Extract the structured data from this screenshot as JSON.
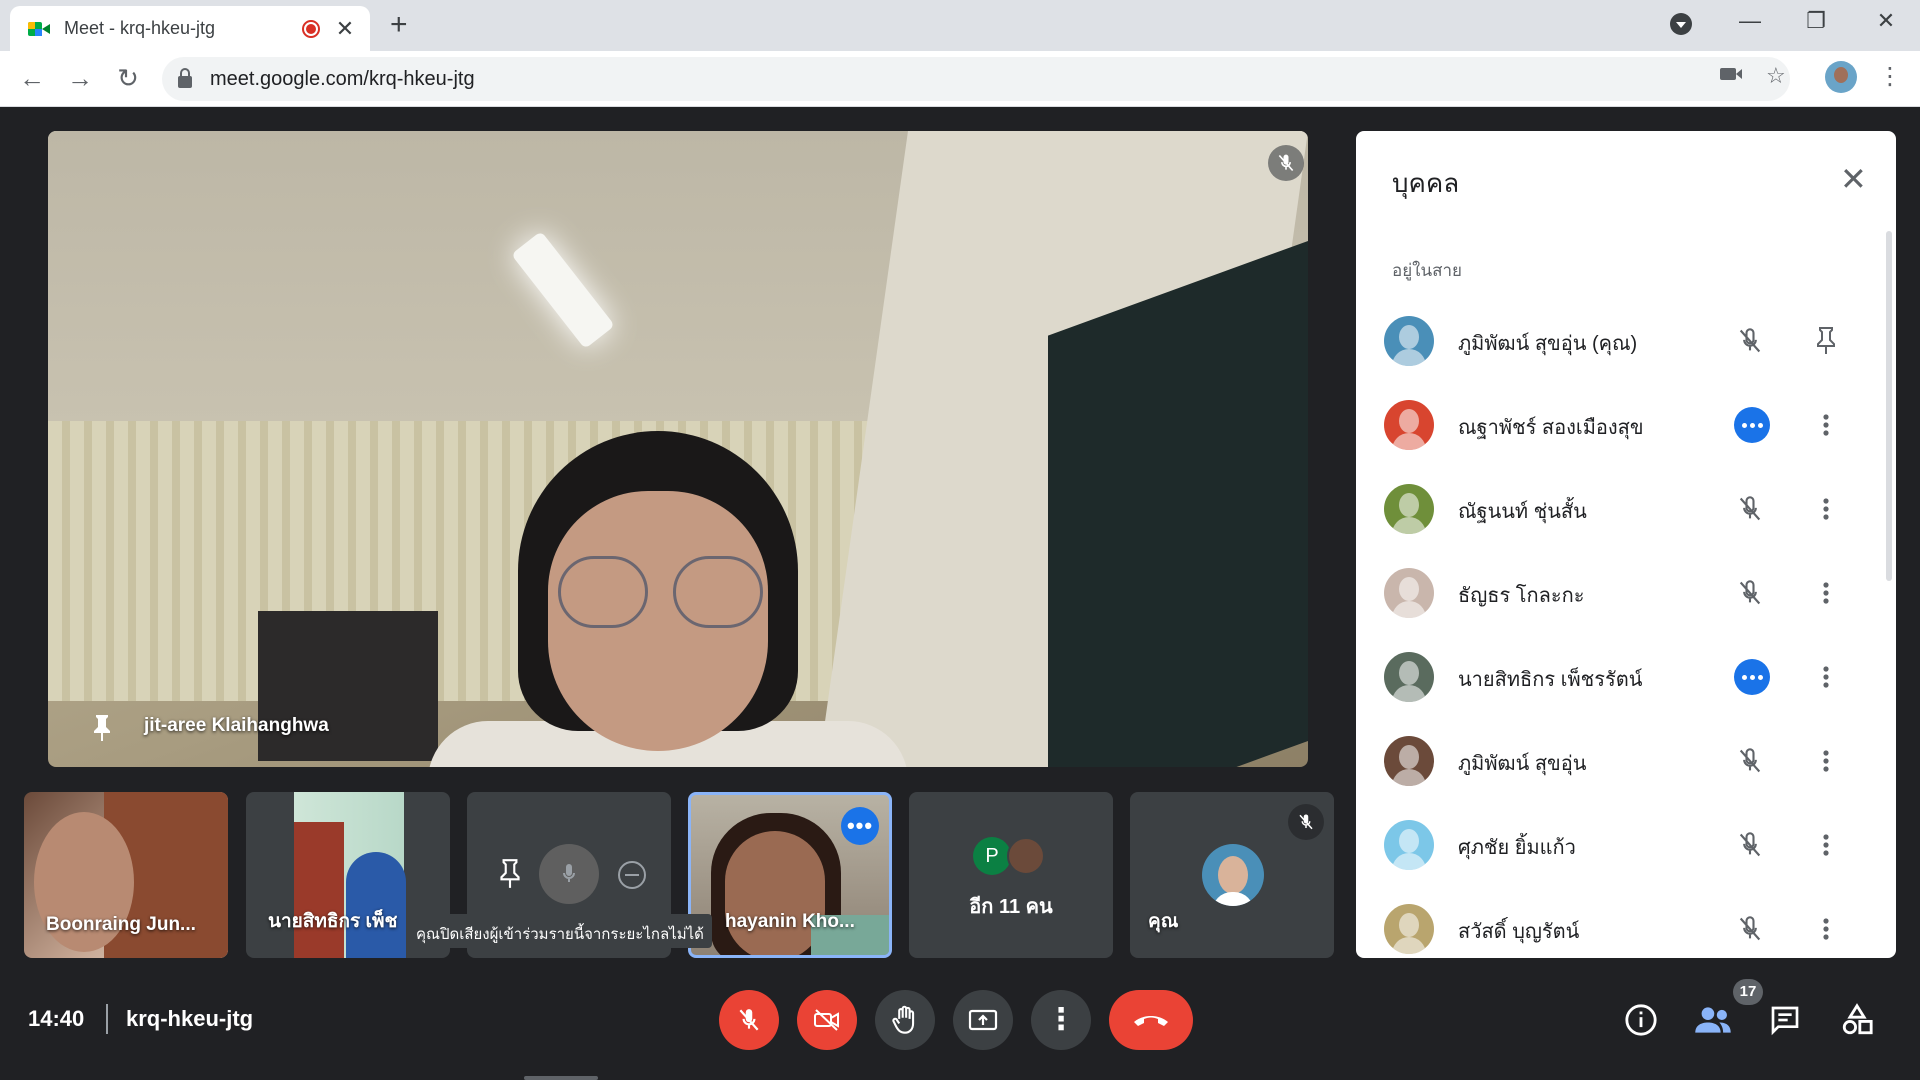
{
  "browser": {
    "tab_title": "Meet - krq-hkeu-jtg",
    "tab_close": "✕",
    "new_tab": "+",
    "url": "meet.google.com/krq-hkeu-jtg",
    "window_min": "—",
    "window_max": "❐",
    "window_close": "✕",
    "nav_back": "←",
    "nav_forward": "→",
    "nav_reload": "↻",
    "star": "☆",
    "menu": "⋮"
  },
  "main_video": {
    "participant_name": "jit-aree Klaihanghwa",
    "pinned": true,
    "muted": true
  },
  "thumbnails": [
    {
      "name": "Boonraing Jun...",
      "state": "video"
    },
    {
      "name": "นายสิทธิกร เพ็ช",
      "state": "video"
    },
    {
      "name": "",
      "state": "hover-controls"
    },
    {
      "name": "hayanin Kho...",
      "state": "video-active-speaking"
    },
    {
      "name": "อีก 11 คน",
      "state": "overflow",
      "letter": "P"
    },
    {
      "name": "คุณ",
      "state": "self-muted"
    }
  ],
  "tooltip": "คุณปิดเสียงผู้เข้าร่วมรายนี้จากระยะไกลไม่ได้",
  "bottom_bar": {
    "time": "14:40",
    "meeting_code": "krq-hkeu-jtg",
    "participant_count": "17",
    "more_options": "⋮"
  },
  "people_panel": {
    "title": "บุคคล",
    "close": "✕",
    "section_label": "อยู่ในสาย",
    "people": [
      {
        "name": "ภูมิพัฒน์ สุขอุ่น (คุณ)",
        "mic": "muted",
        "action": "pin",
        "avatar_color": "#4a8fb8"
      },
      {
        "name": "ณฐาพัชร์ สองเมืองสุข",
        "mic": "speaking",
        "action": "more",
        "avatar_color": "#d8452f"
      },
      {
        "name": "ณัฐนนท์ ชุ่นสั้น",
        "mic": "muted",
        "action": "more",
        "avatar_color": "#6f8f3a"
      },
      {
        "name": "ธัญธร โกละกะ",
        "mic": "muted",
        "action": "more",
        "avatar_color": "#c9b6ac"
      },
      {
        "name": "นายสิทธิกร เพ็ชรรัตน์",
        "mic": "speaking",
        "action": "more",
        "avatar_color": "#5a6b5e"
      },
      {
        "name": "ภูมิพัฒน์ สุขอุ่น",
        "mic": "muted",
        "action": "more",
        "avatar_color": "#6b4a3a"
      },
      {
        "name": "ศุภชัย ยิ้มแก้ว",
        "mic": "muted",
        "action": "more",
        "avatar_color": "#7cc7e8"
      },
      {
        "name": "สวัสดิ์ บุญรัตน์",
        "mic": "muted",
        "action": "more",
        "avatar_color": "#b9a56e"
      }
    ]
  },
  "colors": {
    "background": "#202124",
    "tile": "#3c4043",
    "accent_blue": "#1a73e8",
    "danger_red": "#ea4335",
    "active_border": "#8ab4f8"
  }
}
